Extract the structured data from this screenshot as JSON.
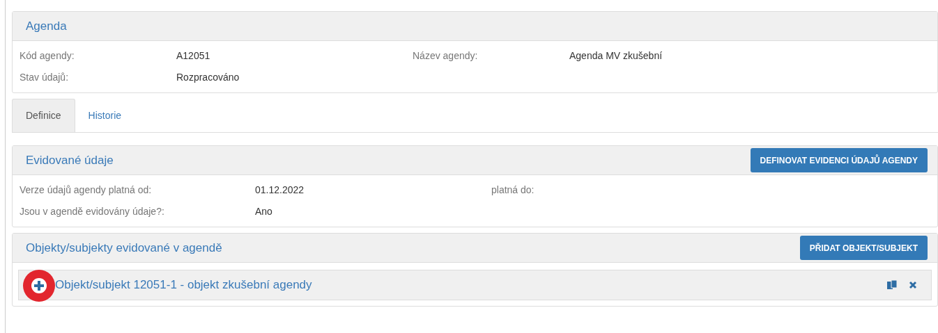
{
  "agenda": {
    "title": "Agenda",
    "fields": [
      {
        "label": "Kód agendy:",
        "value": "A12051"
      },
      {
        "label": "Název agendy:",
        "value": "Agenda MV zkušební"
      },
      {
        "label": "Stav údajů:",
        "value": "Rozpracováno"
      }
    ]
  },
  "tabs": [
    {
      "label": "Definice",
      "selected": true
    },
    {
      "label": "Historie",
      "selected": false
    }
  ],
  "evidence": {
    "title": "Evidované údaje",
    "button": "DEFINOVAT EVIDENCI ÚDAJŮ AGENDY",
    "fields": [
      {
        "label": "Verze údajů agendy platná od:",
        "value": "01.12.2022"
      },
      {
        "label": "platná do:"
      },
      {
        "label": "Jsou v agendě evidovány údaje?:",
        "value": "Ano"
      }
    ]
  },
  "objects": {
    "title": "Objekty/subjekty evidované v agendě",
    "button": "PŘIDAT OBJEKT/SUBJEKT",
    "items": [
      {
        "title": "Objekt/subjekt 12051-1 - objekt zkušební agendy",
        "highlighted": true
      }
    ]
  }
}
